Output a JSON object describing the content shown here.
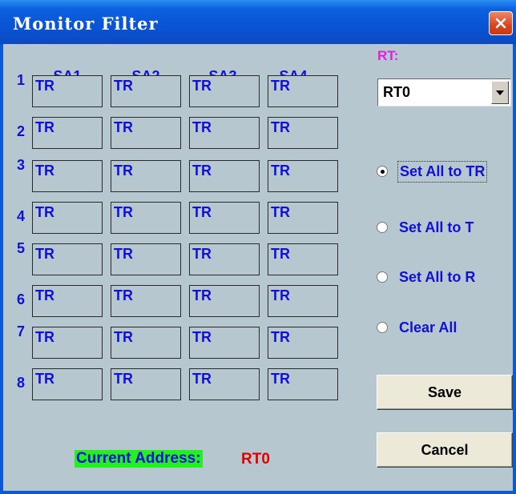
{
  "window": {
    "title": "Monitor Filter"
  },
  "grid": {
    "columns": [
      "SA1",
      "SA2",
      "SA3",
      "SA4"
    ],
    "rows": [
      {
        "num": "1",
        "cells": [
          "TR",
          "TR",
          "TR",
          "TR"
        ]
      },
      {
        "num": "2",
        "cells": [
          "TR",
          "TR",
          "TR",
          "TR"
        ]
      },
      {
        "num": "3",
        "cells": [
          "TR",
          "TR",
          "TR",
          "TR"
        ]
      },
      {
        "num": "4",
        "cells": [
          "TR",
          "TR",
          "TR",
          "TR"
        ]
      },
      {
        "num": "5",
        "cells": [
          "TR",
          "TR",
          "TR",
          "TR"
        ]
      },
      {
        "num": "6",
        "cells": [
          "TR",
          "TR",
          "TR",
          "TR"
        ]
      },
      {
        "num": "7",
        "cells": [
          "TR",
          "TR",
          "TR",
          "TR"
        ]
      },
      {
        "num": "8",
        "cells": [
          "TR",
          "TR",
          "TR",
          "TR"
        ]
      }
    ]
  },
  "rt": {
    "label": "RT:",
    "selected": "RT0"
  },
  "options": [
    {
      "label": "Set All to TR",
      "checked": true
    },
    {
      "label": "Set All to T",
      "checked": false
    },
    {
      "label": "Set All to R",
      "checked": false
    },
    {
      "label": "Clear All",
      "checked": false
    }
  ],
  "buttons": {
    "save": "Save",
    "cancel": "Cancel"
  },
  "status": {
    "label": "Current Address:",
    "value": "RT0"
  },
  "colors": {
    "titlebar": "#0a55d6",
    "background": "#b6c7d0",
    "text_blue": "#1010d8",
    "rt_label": "#e020e0",
    "address_highlight": "#23f021",
    "address_value": "#e00000"
  },
  "icons": {
    "close": "close-icon",
    "dropdown": "chevron-down-icon"
  }
}
